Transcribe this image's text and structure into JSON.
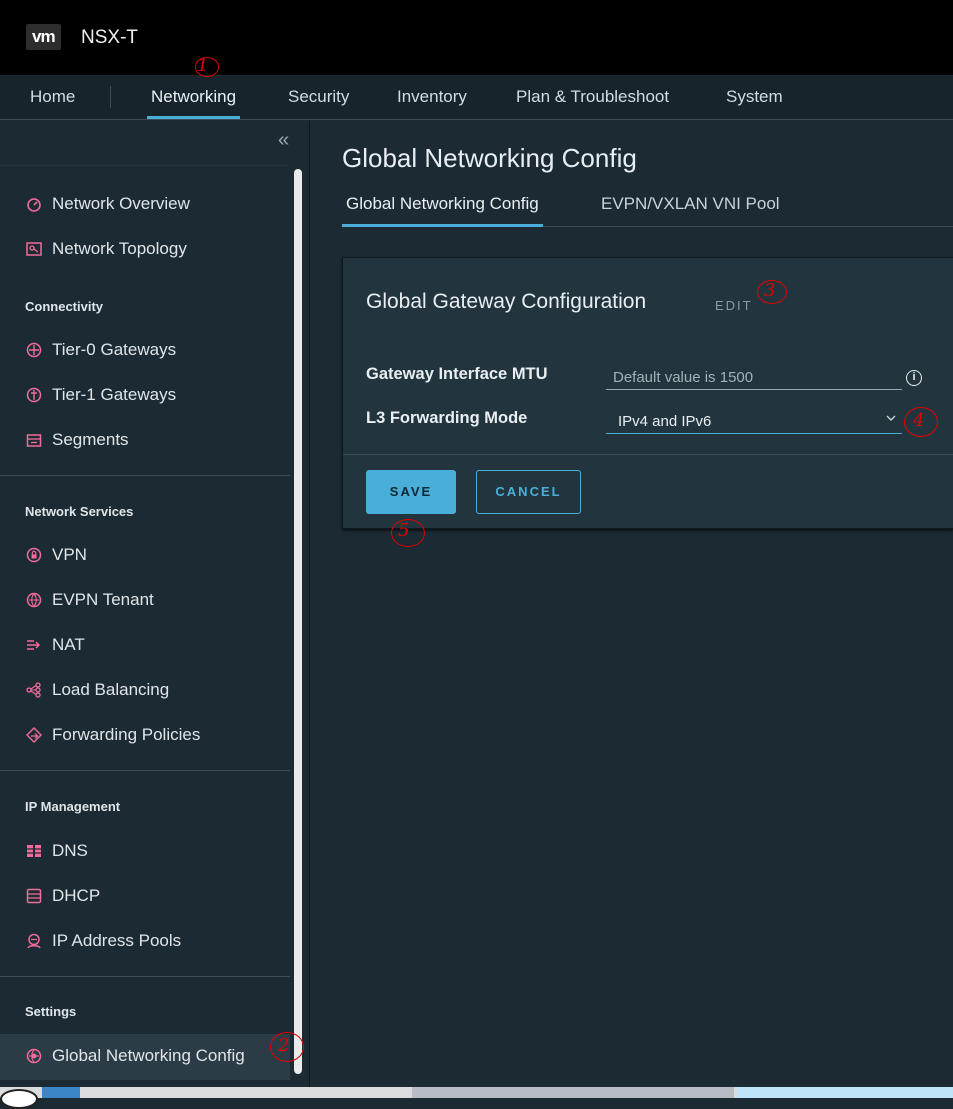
{
  "app": {
    "logo": "vm",
    "name": "NSX-T"
  },
  "nav": {
    "items": [
      {
        "label": "Home"
      },
      {
        "label": "Networking"
      },
      {
        "label": "Security"
      },
      {
        "label": "Inventory"
      },
      {
        "label": "Plan & Troubleshoot"
      },
      {
        "label": "System"
      }
    ],
    "active": "Networking"
  },
  "sidebar": {
    "collapse_glyph": "«",
    "items": [
      {
        "label": "Network Overview",
        "icon": "gauge-icon"
      },
      {
        "label": "Network Topology",
        "icon": "topology-icon"
      }
    ],
    "sections": [
      {
        "title": "Connectivity",
        "items": [
          {
            "label": "Tier-0 Gateways",
            "icon": "tier0-gateway-icon"
          },
          {
            "label": "Tier-1 Gateways",
            "icon": "tier1-gateway-icon"
          },
          {
            "label": "Segments",
            "icon": "segments-icon"
          }
        ]
      },
      {
        "title": "Network Services",
        "items": [
          {
            "label": "VPN",
            "icon": "vpn-lock-icon"
          },
          {
            "label": "EVPN Tenant",
            "icon": "evpn-icon"
          },
          {
            "label": "NAT",
            "icon": "nat-icon"
          },
          {
            "label": "Load Balancing",
            "icon": "load-balancer-icon"
          },
          {
            "label": "Forwarding Policies",
            "icon": "forwarding-icon"
          }
        ]
      },
      {
        "title": "IP Management",
        "items": [
          {
            "label": "DNS",
            "icon": "dns-icon"
          },
          {
            "label": "DHCP",
            "icon": "dhcp-icon"
          },
          {
            "label": "IP Address Pools",
            "icon": "ip-pool-icon"
          }
        ]
      },
      {
        "title": "Settings",
        "items": [
          {
            "label": "Global Networking Config",
            "icon": "global-config-icon"
          }
        ]
      }
    ]
  },
  "main": {
    "title": "Global Networking Config",
    "tabs": [
      {
        "label": "Global Networking Config"
      },
      {
        "label": "EVPN/VXLAN VNI Pool"
      }
    ],
    "card": {
      "title": "Global Gateway Configuration",
      "edit_label": "EDIT",
      "fields": [
        {
          "label": "Gateway Interface MTU",
          "placeholder": "Default value is 1500"
        },
        {
          "label": "L3 Forwarding Mode",
          "value": "IPv4 and IPv6"
        }
      ],
      "save_label": "SAVE",
      "cancel_label": "CANCEL"
    }
  },
  "annotations": [
    "1",
    "2",
    "3",
    "4",
    "5"
  ],
  "colors": {
    "accent": "#49afd9",
    "icon": "#f36b9a",
    "annotation": "#e00000"
  }
}
